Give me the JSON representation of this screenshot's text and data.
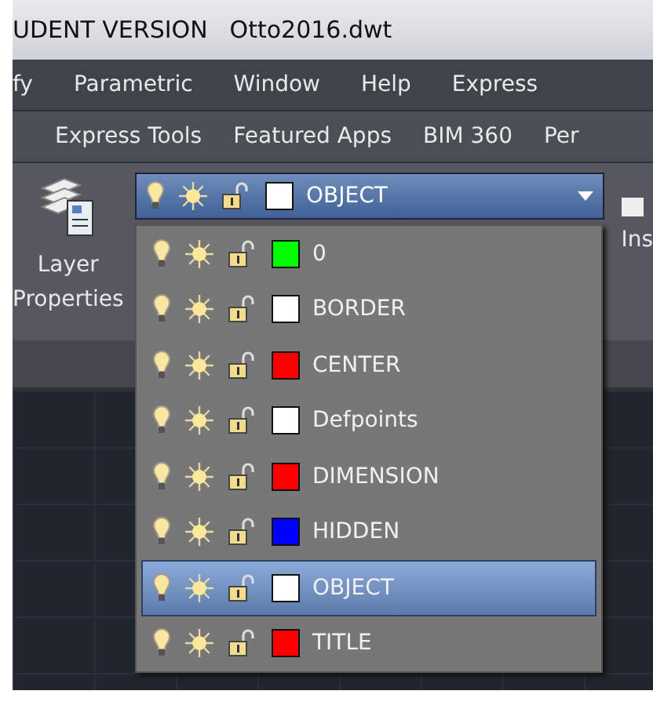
{
  "title_bar": {
    "product": "UDENT VERSION",
    "file": "Otto2016.dwt"
  },
  "menu_bar": [
    "fy",
    "Parametric",
    "Window",
    "Help",
    "Express"
  ],
  "ribbon_tabs": [
    "Express Tools",
    "Featured Apps",
    "BIM 360",
    "Per"
  ],
  "ribbon": {
    "layer_properties": "Layer\nProperties",
    "insert": "Ins"
  },
  "layer_dropdown": {
    "current": {
      "name": "OBJECT",
      "color": "#ffffff"
    },
    "layers": [
      {
        "name": "0",
        "color": "#00ff00",
        "selected": false
      },
      {
        "name": "BORDER",
        "color": "#ffffff",
        "selected": false
      },
      {
        "name": "CENTER",
        "color": "#ff0000",
        "selected": false
      },
      {
        "name": "Defpoints",
        "color": "#ffffff",
        "selected": false
      },
      {
        "name": "DIMENSION",
        "color": "#ff0000",
        "selected": false
      },
      {
        "name": "HIDDEN",
        "color": "#0000ff",
        "selected": false
      },
      {
        "name": "OBJECT",
        "color": "#ffffff",
        "selected": true
      },
      {
        "name": "TITLE",
        "color": "#ff0000",
        "selected": false
      }
    ]
  }
}
